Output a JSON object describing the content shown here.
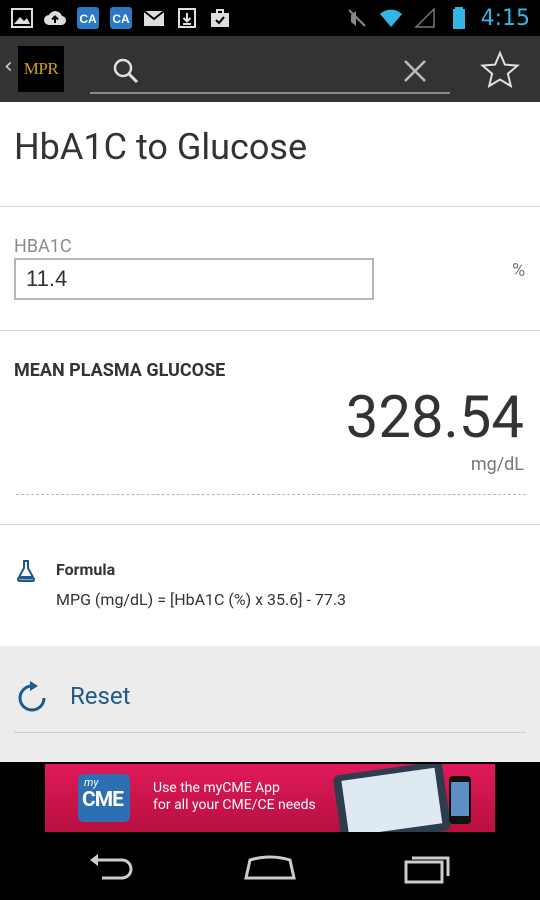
{
  "status_bar": {
    "time": "4:15",
    "left_icons": [
      "image-icon",
      "cloud-upload-icon",
      "ca-icon",
      "ca-icon",
      "gmail-icon",
      "download-icon",
      "briefcase-icon"
    ],
    "right_icons": [
      "mute-icon",
      "wifi-icon",
      "signal-icon",
      "battery-icon"
    ],
    "ca_label": "CA",
    "time_color": "#33b5e5"
  },
  "action_bar": {
    "logo_text": "MPR",
    "back_icon": "‹",
    "search": {
      "value": "",
      "placeholder": ""
    }
  },
  "page": {
    "title": "HbA1C to Glucose",
    "input_label": "HBA1C",
    "input_value": "11.4",
    "input_unit": "%",
    "result_label": "MEAN PLASMA GLUCOSE",
    "result_value": "328.54",
    "result_unit": "mg/dL",
    "formula_title": "Formula",
    "formula_text": "MPG (mg/dL) = [HbA1C (%) x 35.6] - 77.3",
    "reset_label": "Reset",
    "accent_color": "#1f5a8c"
  },
  "ad": {
    "brand_small": "my",
    "brand_big": "CME",
    "line1": "Use the myCME App",
    "line2": "for all your CME/CE needs"
  }
}
